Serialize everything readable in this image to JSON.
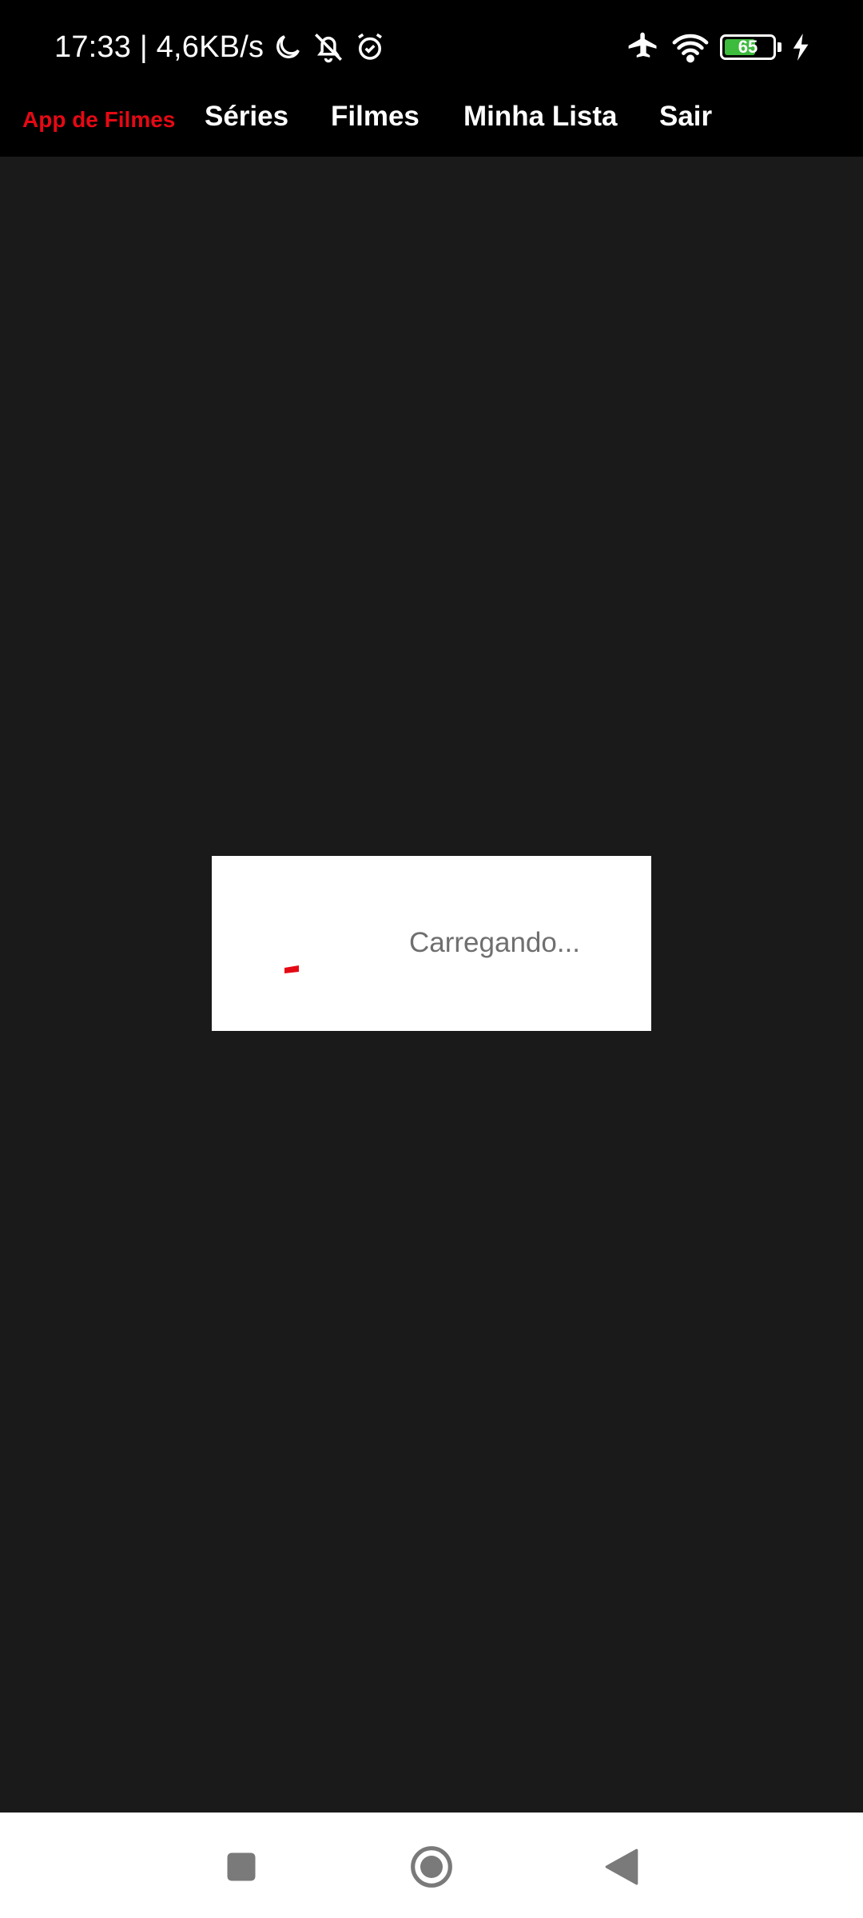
{
  "status_bar": {
    "time_speed": "17:33 | 4,6KB/s",
    "battery_level": "65",
    "battery_percent": 65,
    "icons": [
      "moon-icon",
      "bell-off-icon",
      "alarm-icon",
      "airplane-icon",
      "wifi-icon",
      "battery-icon",
      "charging-icon"
    ]
  },
  "nav": {
    "brand": "App de Filmes",
    "links": [
      "Séries",
      "Filmes",
      "Minha Lista",
      "Sair"
    ],
    "brand_color": "#e50914"
  },
  "dialog": {
    "message": "Carregando..."
  },
  "system_nav": {
    "icons": [
      "recents-icon",
      "home-icon",
      "back-icon"
    ]
  },
  "colors": {
    "background": "#1a1a1a",
    "bar": "#000000",
    "accent": "#e50914",
    "battery": "#3dbb3d"
  }
}
